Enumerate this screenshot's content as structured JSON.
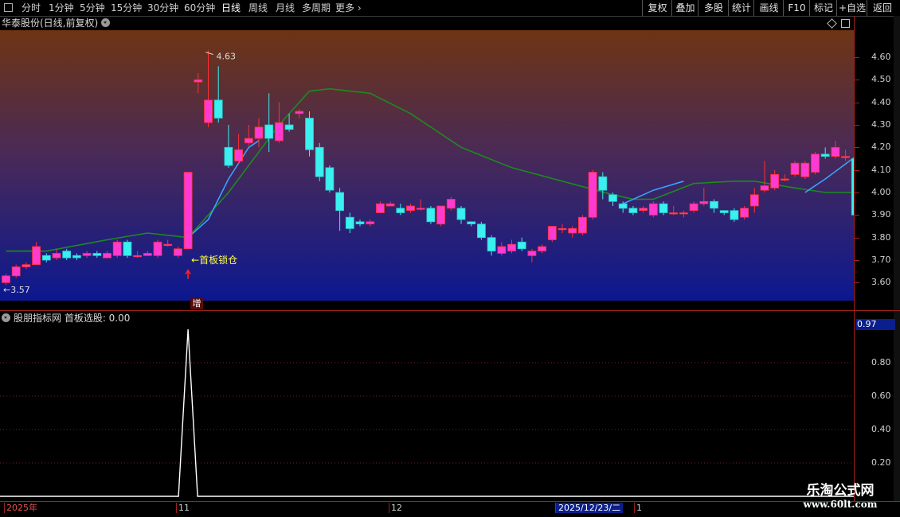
{
  "toolbar": {
    "periods": [
      "分时",
      "1分钟",
      "5分钟",
      "15分钟",
      "30分钟",
      "60分钟",
      "日线",
      "周线",
      "月线",
      "多周期",
      "更多"
    ],
    "active_period": "日线",
    "right_buttons": [
      "复权",
      "叠加",
      "多股",
      "统计",
      "画线",
      "F10",
      "标记",
      "+自选",
      "返回"
    ]
  },
  "main_chart": {
    "title": "华泰股份(日线,前复权)",
    "yticks": [
      "4.60",
      "4.50",
      "4.40",
      "4.30",
      "4.20",
      "4.10",
      "4.00",
      "3.90",
      "3.80",
      "3.70",
      "3.60"
    ],
    "ymin": 3.52,
    "ymax": 4.72,
    "high_label": "4.63",
    "low_label": "3.57",
    "signal_label": "←首板锁仓",
    "bottom_marker": "增",
    "colors": {
      "up": "#ff3ad2",
      "down": "#3af0f0",
      "ma_long": "#1e8a1e",
      "ma_short": "#3aa0ff",
      "signal": "#ffff40"
    }
  },
  "sub_chart": {
    "title": "股朋指标网 首板选股: 0.00",
    "current_value": "0.97",
    "yticks": [
      "0.80",
      "0.60",
      "0.40",
      "0.20"
    ]
  },
  "date_axis": {
    "labels": [
      "2025年",
      "11",
      "12",
      "2025/12/23/二",
      "1"
    ]
  },
  "brand": {
    "name": "乐淘公式网",
    "url": "www.60lt.com"
  },
  "chart_data": {
    "type": "candlestick",
    "candles": [
      [
        3.6,
        3.63,
        3.59,
        3.64
      ],
      [
        3.63,
        3.67,
        3.62,
        3.68
      ],
      [
        3.67,
        3.68,
        3.66,
        3.69
      ],
      [
        3.68,
        3.76,
        3.68,
        3.78
      ],
      [
        3.72,
        3.7,
        3.69,
        3.73
      ],
      [
        3.71,
        3.73,
        3.7,
        3.75
      ],
      [
        3.74,
        3.71,
        3.7,
        3.75
      ],
      [
        3.72,
        3.71,
        3.7,
        3.73
      ],
      [
        3.72,
        3.73,
        3.71,
        3.74
      ],
      [
        3.73,
        3.72,
        3.71,
        3.74
      ],
      [
        3.71,
        3.73,
        3.71,
        3.74
      ],
      [
        3.72,
        3.78,
        3.71,
        3.79
      ],
      [
        3.78,
        3.72,
        3.71,
        3.79
      ],
      [
        3.72,
        3.72,
        3.71,
        3.74
      ],
      [
        3.72,
        3.73,
        3.72,
        3.74
      ],
      [
        3.72,
        3.78,
        3.71,
        3.79
      ],
      [
        3.77,
        3.77,
        3.76,
        3.79
      ],
      [
        3.72,
        3.75,
        3.71,
        3.76
      ],
      [
        3.75,
        4.09,
        3.75,
        4.09
      ],
      [
        4.49,
        4.5,
        4.44,
        4.53
      ],
      [
        4.31,
        4.41,
        4.29,
        4.63
      ],
      [
        4.41,
        4.33,
        4.31,
        4.56
      ],
      [
        4.2,
        4.12,
        4.11,
        4.3
      ],
      [
        4.14,
        4.19,
        4.13,
        4.26
      ],
      [
        4.22,
        4.24,
        4.21,
        4.3
      ],
      [
        4.24,
        4.29,
        4.2,
        4.33
      ],
      [
        4.3,
        4.24,
        4.18,
        4.44
      ],
      [
        4.23,
        4.31,
        4.22,
        4.4
      ],
      [
        4.3,
        4.28,
        4.27,
        4.35
      ],
      [
        4.35,
        4.36,
        4.33,
        4.37
      ],
      [
        4.33,
        4.19,
        4.16,
        4.36
      ],
      [
        4.2,
        4.07,
        4.05,
        4.22
      ],
      [
        4.11,
        4.01,
        4.0,
        4.12
      ],
      [
        4.0,
        3.92,
        3.83,
        4.02
      ],
      [
        3.89,
        3.84,
        3.82,
        3.91
      ],
      [
        3.87,
        3.86,
        3.85,
        3.88
      ],
      [
        3.86,
        3.87,
        3.85,
        3.88
      ],
      [
        3.91,
        3.95,
        3.91,
        3.96
      ],
      [
        3.94,
        3.95,
        3.94,
        3.96
      ],
      [
        3.93,
        3.91,
        3.9,
        3.95
      ],
      [
        3.92,
        3.94,
        3.91,
        3.95
      ],
      [
        3.93,
        3.93,
        3.92,
        3.97
      ],
      [
        3.93,
        3.87,
        3.86,
        3.94
      ],
      [
        3.86,
        3.94,
        3.85,
        3.94
      ],
      [
        3.93,
        3.97,
        3.92,
        3.98
      ],
      [
        3.93,
        3.88,
        3.86,
        3.94
      ],
      [
        3.87,
        3.86,
        3.85,
        3.87
      ],
      [
        3.86,
        3.8,
        3.79,
        3.87
      ],
      [
        3.8,
        3.74,
        3.72,
        3.81
      ],
      [
        3.73,
        3.76,
        3.72,
        3.78
      ],
      [
        3.74,
        3.77,
        3.73,
        3.79
      ],
      [
        3.78,
        3.75,
        3.74,
        3.8
      ],
      [
        3.72,
        3.74,
        3.69,
        3.75
      ],
      [
        3.74,
        3.76,
        3.73,
        3.77
      ],
      [
        3.79,
        3.85,
        3.78,
        3.85
      ],
      [
        3.84,
        3.84,
        3.82,
        3.86
      ],
      [
        3.82,
        3.84,
        3.8,
        3.85
      ],
      [
        3.82,
        3.89,
        3.81,
        3.9
      ],
      [
        3.89,
        4.09,
        3.88,
        4.1
      ],
      [
        4.07,
        4.01,
        3.97,
        4.09
      ],
      [
        3.99,
        3.96,
        3.94,
        4.0
      ],
      [
        3.95,
        3.93,
        3.91,
        3.96
      ],
      [
        3.93,
        3.91,
        3.9,
        3.94
      ],
      [
        3.92,
        3.93,
        3.91,
        3.94
      ],
      [
        3.9,
        3.95,
        3.89,
        3.96
      ],
      [
        3.95,
        3.91,
        3.9,
        3.96
      ],
      [
        3.91,
        3.91,
        3.9,
        3.94
      ],
      [
        3.91,
        3.91,
        3.89,
        3.92
      ],
      [
        3.92,
        3.95,
        3.91,
        3.96
      ],
      [
        3.95,
        3.96,
        3.94,
        4.02
      ],
      [
        3.96,
        3.93,
        3.91,
        3.97
      ],
      [
        3.92,
        3.91,
        3.9,
        3.92
      ],
      [
        3.92,
        3.88,
        3.87,
        3.93
      ],
      [
        3.89,
        3.93,
        3.88,
        3.94
      ],
      [
        3.94,
        3.99,
        3.91,
        4.02
      ],
      [
        4.01,
        4.03,
        4.0,
        4.14
      ],
      [
        4.02,
        4.08,
        4.01,
        4.1
      ],
      [
        4.06,
        4.06,
        4.05,
        4.08
      ],
      [
        4.08,
        4.13,
        4.07,
        4.14
      ],
      [
        4.07,
        4.13,
        4.06,
        4.14
      ],
      [
        4.09,
        4.17,
        4.08,
        4.18
      ],
      [
        4.17,
        4.16,
        4.15,
        4.2
      ],
      [
        4.16,
        4.2,
        4.15,
        4.23
      ],
      [
        4.16,
        4.16,
        4.14,
        4.19
      ],
      [
        4.15,
        3.9,
        3.89,
        4.16
      ]
    ],
    "ma_long": [
      [
        0,
        3.74
      ],
      [
        4,
        3.74
      ],
      [
        10,
        3.79
      ],
      [
        14,
        3.82
      ],
      [
        18,
        3.8
      ],
      [
        22,
        4.0
      ],
      [
        27,
        4.3
      ],
      [
        30,
        4.45
      ],
      [
        32,
        4.46
      ],
      [
        36,
        4.44
      ],
      [
        40,
        4.35
      ],
      [
        45,
        4.2
      ],
      [
        50,
        4.11
      ],
      [
        55,
        4.05
      ],
      [
        60,
        3.99
      ],
      [
        62,
        3.97
      ],
      [
        64,
        3.97
      ],
      [
        68,
        4.04
      ],
      [
        72,
        4.05
      ],
      [
        74,
        4.05
      ],
      [
        78,
        4.02
      ],
      [
        81,
        4.0
      ],
      [
        84,
        4.0
      ]
    ],
    "ma_short_a": [
      [
        18,
        3.8
      ],
      [
        20,
        3.88
      ],
      [
        22,
        4.06
      ],
      [
        24,
        4.2
      ],
      [
        25,
        4.23
      ]
    ],
    "ma_short_b": [
      [
        61,
        3.95
      ],
      [
        64,
        4.01
      ],
      [
        67,
        4.05
      ]
    ],
    "ma_short_c": [
      [
        79,
        4.0
      ],
      [
        81,
        4.06
      ],
      [
        84,
        4.16
      ]
    ],
    "indicator_spike_index": 18
  }
}
